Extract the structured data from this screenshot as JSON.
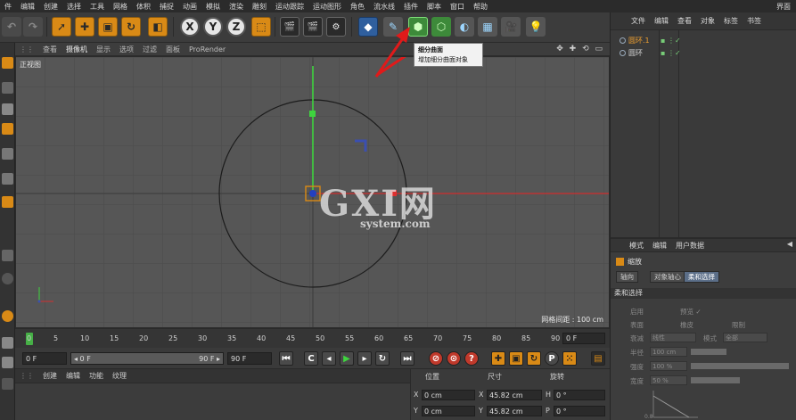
{
  "menubar": {
    "items": [
      "件",
      "编辑",
      "创建",
      "选择",
      "工具",
      "网格",
      "体积",
      "捕捉",
      "动画",
      "模拟",
      "渲染",
      "雕刻",
      "运动跟踪",
      "运动图形",
      "角色",
      "流水线",
      "插件",
      "脚本",
      "窗口",
      "帮助"
    ],
    "layout_label": "界面"
  },
  "toolbar": {
    "xyz": [
      "X",
      "Y",
      "Z"
    ]
  },
  "viewport": {
    "menu": [
      "查看",
      "摄像机",
      "显示",
      "选项",
      "过滤",
      "面板",
      "ProRender"
    ],
    "view_name": "正视图",
    "grid_spacing": "网格间距 : 100 cm",
    "controls": "✥ ✚ ⟲ ▭"
  },
  "tooltip": {
    "title": "细分曲面",
    "description": "增加细分曲面对象"
  },
  "watermark": {
    "big": "GXI网",
    "small": "system.com"
  },
  "timeline": {
    "ticks": [
      "0",
      "5",
      "10",
      "15",
      "20",
      "25",
      "30",
      "35",
      "40",
      "45",
      "50",
      "55",
      "60",
      "65",
      "70",
      "75",
      "80",
      "85",
      "90"
    ],
    "end_field": "0 F"
  },
  "transport": {
    "start_frame": "0 F",
    "range_start": "◂ 0 F",
    "range_end": "90 F ▸",
    "end_frame": "90 F"
  },
  "bottom_left": {
    "tabs": [
      "创建",
      "编辑",
      "功能",
      "纹理"
    ]
  },
  "coordinates": {
    "headers": [
      "位置",
      "尺寸",
      "旋转"
    ],
    "rows": [
      {
        "axis": "X",
        "pos": "0 cm",
        "size_axis": "X",
        "size": "45.82 cm",
        "rot_axis": "H",
        "rot": "0 °"
      },
      {
        "axis": "Y",
        "pos": "0 cm",
        "size_axis": "Y",
        "size": "45.82 cm",
        "rot_axis": "P",
        "rot": "0 °"
      }
    ]
  },
  "object_manager": {
    "menu": [
      "文件",
      "编辑",
      "查看",
      "对象",
      "标签",
      "书签"
    ],
    "objects": [
      {
        "name": "圆环.1",
        "selected": true
      },
      {
        "name": "圆环",
        "selected": false
      }
    ]
  },
  "attribute_manager": {
    "menu": [
      "模式",
      "编辑",
      "用户数据"
    ],
    "title": "缩放",
    "tabs": [
      "轴向",
      "对象轴心",
      "柔和选择"
    ],
    "section": "柔和选择",
    "rows": [
      {
        "label": "启用",
        "extra": "预览 ✓"
      },
      {
        "label": "表面",
        "extra": "橡皮"
      },
      {
        "label": "衰减",
        "extra": "线性"
      },
      {
        "label": "半径",
        "extra": "100 cm"
      },
      {
        "label": "强度",
        "extra": "100 %"
      },
      {
        "label": "宽度",
        "extra": "50 %"
      }
    ],
    "extra_labels": [
      "限制",
      "模式",
      "全部"
    ],
    "graph_label": "0.8"
  },
  "colors": {
    "accent_orange": "#d98a16",
    "axis_y": "#3fd43f",
    "axis_x": "#e03030",
    "viewport_bg": "#565656"
  }
}
